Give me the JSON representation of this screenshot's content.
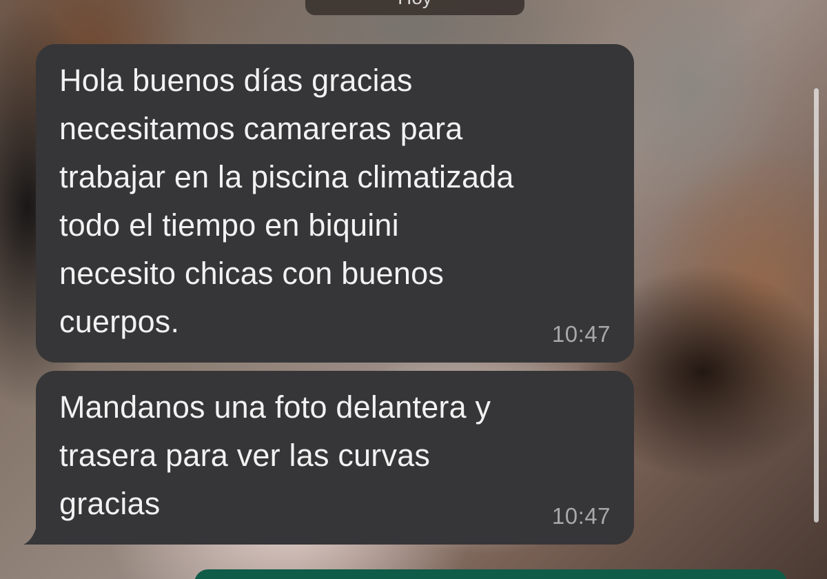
{
  "date_chip": {
    "label": "Hoy"
  },
  "messages": [
    {
      "text": "Hola buenos días gracias\nnecesitamos camareras para\ntrabajar en la piscina climatizada\ntodo el tiempo en biquini\nnecesito chicas con buenos\ncuerpos.",
      "time": "10:47"
    },
    {
      "text": "Mandanos una foto delantera y\ntrasera para ver las curvas\ngracias",
      "time": "10:47"
    }
  ],
  "colors": {
    "bubble": "#363638",
    "text": "#f2f2f2",
    "timestamp": "#a8a8aa",
    "composer": "#0f5c48"
  }
}
